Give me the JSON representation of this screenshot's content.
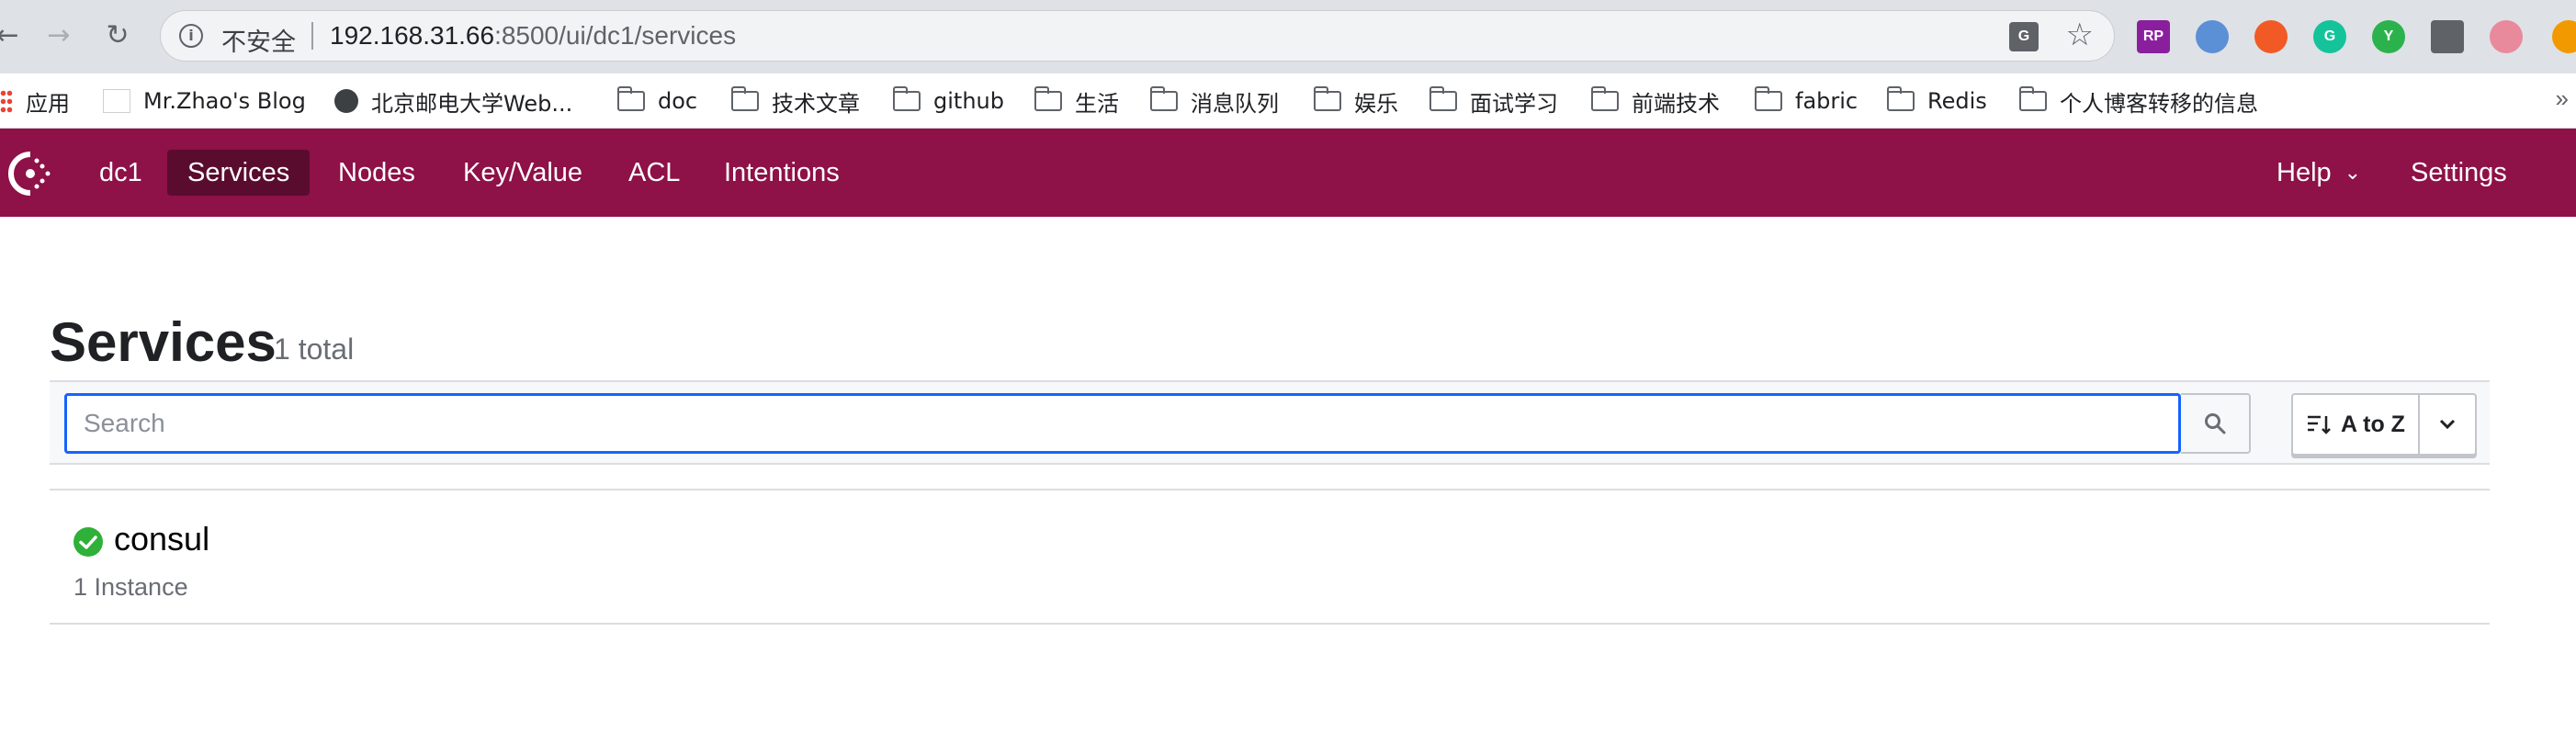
{
  "browser": {
    "security_label": "不安全",
    "url_host": "192.168.31.66",
    "url_path": ":8500/ui/dc1/services",
    "translate_icon_text": "G",
    "bookmarks": [
      {
        "label": "应用",
        "icon": "apps-grid-icon"
      },
      {
        "label": "Mr.Zhao's Blog",
        "icon": "blog-favicon-icon"
      },
      {
        "label": "北京邮电大学Web...",
        "icon": "globe-icon"
      },
      {
        "label": "doc",
        "icon": "folder-icon"
      },
      {
        "label": "技术文章",
        "icon": "folder-icon"
      },
      {
        "label": "github",
        "icon": "folder-icon"
      },
      {
        "label": "生活",
        "icon": "folder-icon"
      },
      {
        "label": "消息队列",
        "icon": "folder-icon"
      },
      {
        "label": "娱乐",
        "icon": "folder-icon"
      },
      {
        "label": "面试学习",
        "icon": "folder-icon"
      },
      {
        "label": "前端技术",
        "icon": "folder-icon"
      },
      {
        "label": "fabric",
        "icon": "folder-icon"
      },
      {
        "label": "Redis",
        "icon": "folder-icon"
      },
      {
        "label": "个人博客转移的信息",
        "icon": "folder-icon"
      }
    ],
    "extensions": [
      {
        "name": "rp-extension-icon",
        "text": "RP",
        "color": "#8a1f9e"
      },
      {
        "name": "blue-extension-icon",
        "text": "",
        "color": "#5b8fd6"
      },
      {
        "name": "orange-extension-icon",
        "text": "",
        "color": "#f15a24"
      },
      {
        "name": "grammarly-icon",
        "text": "G",
        "color": "#15c39a"
      },
      {
        "name": "yellow-y-extension-icon",
        "text": "Y",
        "color": "#2bb24c"
      },
      {
        "name": "puzzle-extensions-icon",
        "text": "",
        "color": "#5f6368"
      },
      {
        "name": "profile-avatar-icon",
        "text": "",
        "color": "#e88a9c"
      },
      {
        "name": "update-icon",
        "text": "",
        "color": "#f29900"
      }
    ]
  },
  "app": {
    "nav": {
      "datacenter": "dc1",
      "services": "Services",
      "nodes": "Nodes",
      "kv": "Key/Value",
      "acl": "ACL",
      "intentions": "Intentions",
      "help": "Help",
      "settings": "Settings"
    },
    "brand_color": "#8e1148"
  },
  "main": {
    "title": "Services",
    "count": "1 total",
    "search_placeholder": "Search",
    "sort_label": "A to Z",
    "services": [
      {
        "name": "consul",
        "instances": "1 Instance",
        "status": "passing",
        "status_color": "#2eb039"
      }
    ]
  }
}
